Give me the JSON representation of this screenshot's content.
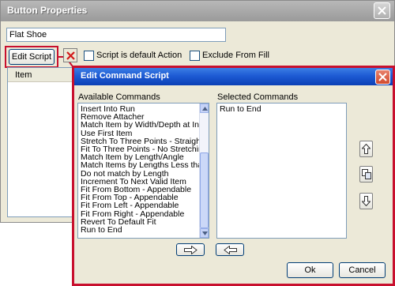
{
  "window": {
    "title": "Button Properties",
    "name_value": "Flat Shoe",
    "edit_script_label": "Edit Script",
    "default_action_label": "Script is default Action",
    "exclude_fill_label": "Exclude From Fill",
    "item_column": "Item"
  },
  "dialog": {
    "title": "Edit Command Script",
    "available_label": "Available Commands",
    "selected_label": "Selected Commands",
    "available_commands": [
      "Insert Into Run",
      "Remove Attacher",
      "Match Item by Width/Depth at Insertion E",
      "Use First Item",
      "Stretch To Three Points - Straight or Ben",
      "Fit To Three Points - No Stretching",
      "Match Item by Length/Angle",
      "Match Items by Lengths Less than",
      "Do not match by Length",
      "Increment To Next Valid Item",
      "Fit From Bottom - Appendable",
      "Fit From Top - Appendable",
      "Fit From Left - Appendable",
      "Fit From Right - Appendable",
      "Revert To Default Fit",
      "Run to End"
    ],
    "selected_commands": [
      "Run to End"
    ],
    "ok_label": "Ok",
    "cancel_label": "Cancel"
  },
  "icons": {
    "window_close": "close-icon",
    "dialog_close": "close-icon",
    "delete": "x-icon",
    "move_up": "arrow-up-icon",
    "copy": "copy-icon",
    "move_down": "arrow-down-icon",
    "add": "arrow-right-icon",
    "remove": "arrow-left-icon"
  },
  "colors": {
    "highlight": "#c8102e",
    "dialog_title_bar": "#1e5bd4",
    "window_title_bar_inactive": "#a8a8a8",
    "face": "#ece9d8"
  }
}
